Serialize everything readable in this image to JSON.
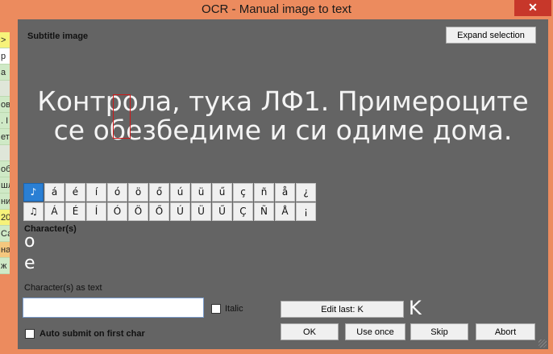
{
  "window": {
    "title": "OCR - Manual image to text",
    "close_glyph": "✕"
  },
  "background_peek": [
    ">",
    "p",
    "a",
    "",
    "ов",
    ". I",
    "ет",
    "",
    "об",
    "шл",
    "ни",
    "20",
    "Са",
    "на",
    "ж"
  ],
  "subtitle_image": {
    "label": "Subtitle image",
    "expand_label": "Expand selection",
    "line1": "Контрола, тука ЛФ1. Примероците",
    "line2": "се обезбедиме и си одиме дома."
  },
  "charset": {
    "row1": [
      "♪",
      "á",
      "é",
      "í",
      "ó",
      "ö",
      "ő",
      "ú",
      "ü",
      "ű",
      "ç",
      "ñ",
      "å",
      "¿"
    ],
    "row2": [
      "♫",
      "Á",
      "É",
      "Í",
      "Ó",
      "Ö",
      "Ő",
      "Ú",
      "Ü",
      "Ű",
      "Ç",
      "Ñ",
      "Å",
      "¡"
    ],
    "selected": "♪"
  },
  "characters": {
    "label": "Character(s)",
    "glyphs": [
      "o",
      "e"
    ]
  },
  "as_text": {
    "label": "Character(s) as text",
    "value": "",
    "italic_label": "Italic",
    "italic_checked": false
  },
  "auto_submit": {
    "label": "Auto submit on first char",
    "checked": false
  },
  "buttons": {
    "edit_last": "Edit last: K",
    "last_glyph": "K",
    "ok": "OK",
    "use_once": "Use once",
    "skip": "Skip",
    "abort": "Abort"
  },
  "colors": {
    "titlebar": "#ec8b5e",
    "client_bg": "#646464",
    "char_marker": "#d01818",
    "selected_char": "#2a7fd4"
  }
}
